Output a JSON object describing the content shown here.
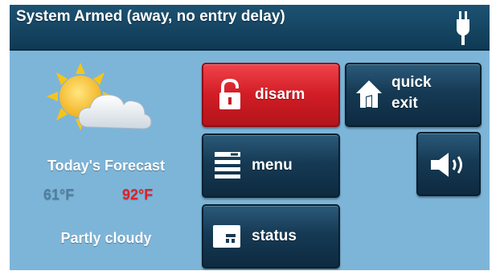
{
  "status_bar": {
    "text": "System Armed (away, no entry delay)",
    "power_icon": "plug-icon"
  },
  "weather": {
    "icon": "partly-cloudy-icon",
    "title": "Today's Forecast",
    "low": "61°F",
    "high": "92°F",
    "condition": "Partly cloudy"
  },
  "buttons": {
    "disarm": {
      "label": "disarm",
      "icon": "unlock-icon"
    },
    "quick_exit": {
      "label_line1": "quick",
      "label_line2": "exit",
      "icon": "house-exit-icon"
    },
    "menu": {
      "label": "menu",
      "icon": "menu-list-icon"
    },
    "status": {
      "label": "status",
      "icon": "status-panel-icon"
    },
    "volume": {
      "icon": "speaker-volume-icon"
    }
  },
  "colors": {
    "background": "#7db5d9",
    "status_bar": "#164766",
    "disarm_red": "#d11d25",
    "button_dark": "#163a54",
    "temp_low": "#4f7f9f",
    "temp_high": "#e0202a"
  }
}
